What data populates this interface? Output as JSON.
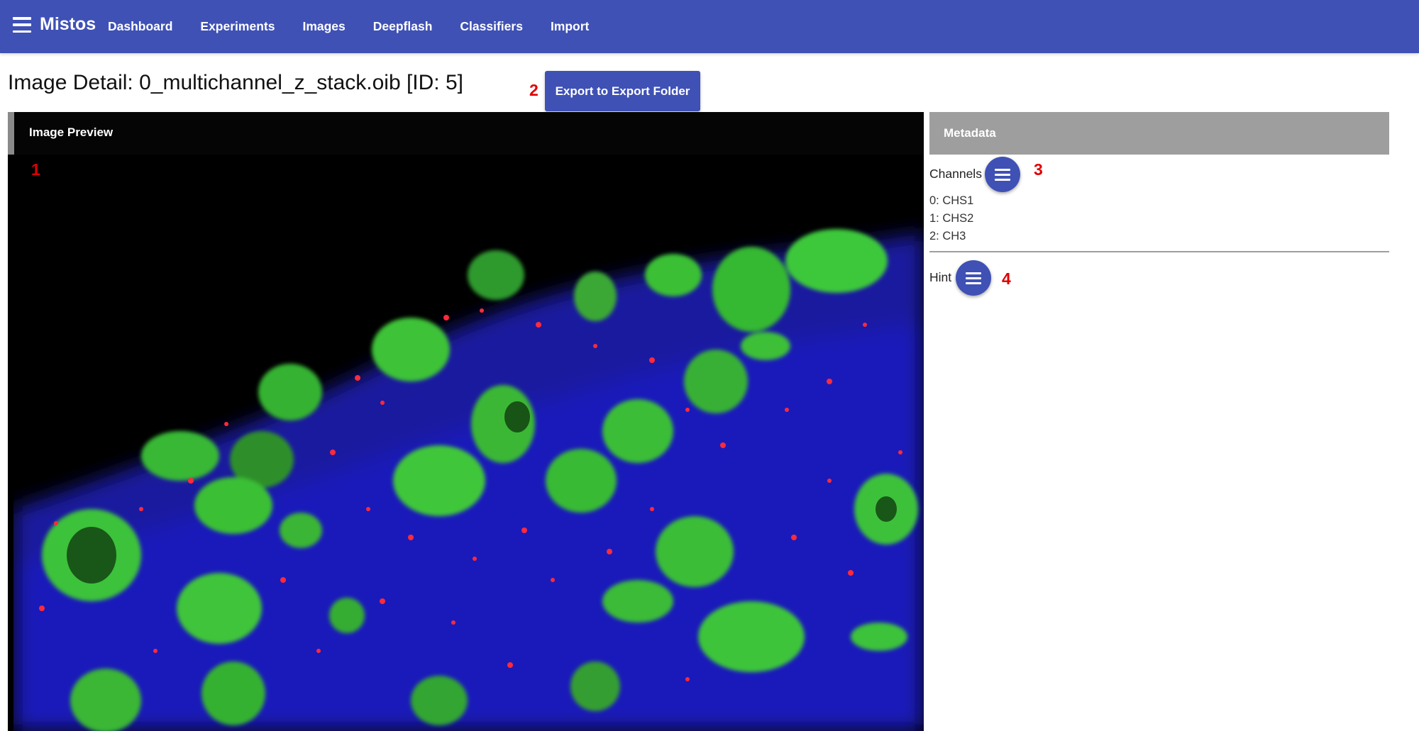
{
  "app": {
    "brand": "Mistos",
    "nav": [
      "Dashboard",
      "Experiments",
      "Images",
      "Deepflash",
      "Classifiers",
      "Import"
    ]
  },
  "page": {
    "title": "Image Detail: 0_multichannel_z_stack.oib [ID: 5]",
    "export_label": "Export to Export Folder"
  },
  "preview": {
    "title": "Image Preview"
  },
  "metadata": {
    "title": "Metadata",
    "channels_label": "Channels",
    "channels": [
      "0: CHS1",
      "1: CHS2",
      "2: CH3"
    ],
    "hint_label": "Hint"
  },
  "annotations": [
    "1",
    "2",
    "3",
    "4"
  ],
  "colors": {
    "primary": "#3f51b5",
    "header_gray": "#9e9e9e",
    "annotation": "#e00000"
  },
  "icons": {
    "menu": "menu-icon",
    "fab": "menu-icon"
  }
}
